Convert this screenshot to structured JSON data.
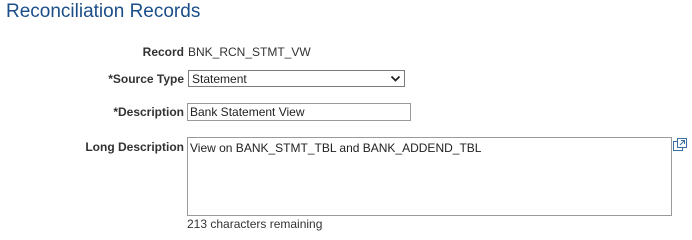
{
  "page": {
    "title": "Reconciliation Records"
  },
  "form": {
    "record": {
      "label": "Record",
      "value": "BNK_RCN_STMT_VW"
    },
    "source_type": {
      "label": "*Source Type",
      "selected": "Statement"
    },
    "description": {
      "label": "*Description",
      "value": "Bank Statement View"
    },
    "long_description": {
      "label": "Long Description",
      "value": "View on BANK_STMT_TBL and BANK_ADDEND_TBL",
      "remaining": "213 characters remaining"
    }
  },
  "icons": {
    "dropdown": "chevron-down-icon",
    "expand": "expand-textarea-icon"
  },
  "colors": {
    "title": "#1b4e89",
    "label": "#333333"
  }
}
